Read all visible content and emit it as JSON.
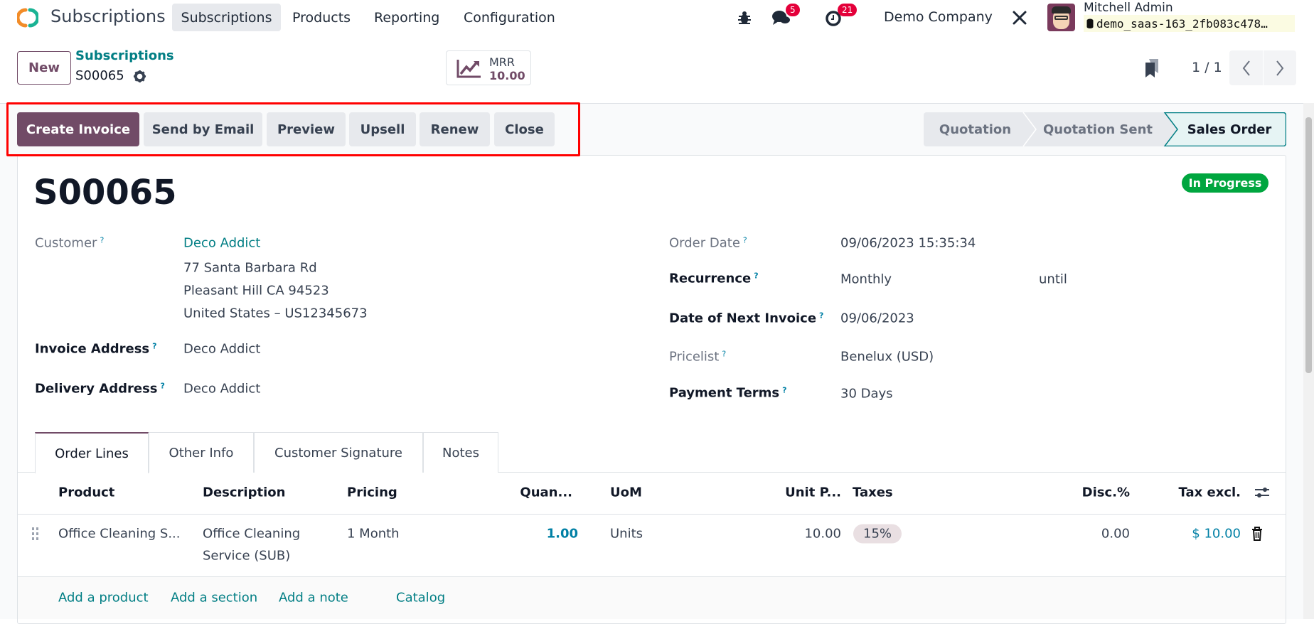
{
  "navbar": {
    "app_name": "Subscriptions",
    "menu": [
      "Subscriptions",
      "Products",
      "Reporting",
      "Configuration"
    ],
    "messages_count": "5",
    "activities_count": "21",
    "company": "Demo Company",
    "user_name": "Mitchell Admin",
    "database": "demo_saas-163_2fb083c478…"
  },
  "control_panel": {
    "new_label": "New",
    "breadcrumb_parent": "Subscriptions",
    "breadcrumb_current": "S00065",
    "mrr_label": "MRR",
    "mrr_value": "10.00",
    "pager": "1 / 1"
  },
  "actions": [
    "Create Invoice",
    "Send by Email",
    "Preview",
    "Upsell",
    "Renew",
    "Close"
  ],
  "statusbar": {
    "stages": [
      "Quotation",
      "Quotation Sent",
      "Sales Order"
    ],
    "current": "Sales Order"
  },
  "form": {
    "title": "S00065",
    "status_badge": "In Progress",
    "help_mark": "?",
    "customer_label": "Customer",
    "customer_name": "Deco Addict",
    "customer_address": [
      "77 Santa Barbara Rd",
      "Pleasant Hill CA 94523",
      "United States – US12345673"
    ],
    "invoice_address_label": "Invoice Address",
    "invoice_address": "Deco Addict",
    "delivery_address_label": "Delivery Address",
    "delivery_address": "Deco Addict",
    "order_date_label": "Order Date",
    "order_date": "09/06/2023 15:35:34",
    "recurrence_label": "Recurrence",
    "recurrence": "Monthly",
    "until_label": "until",
    "next_invoice_label": "Date of Next Invoice",
    "next_invoice": "09/06/2023",
    "pricelist_label": "Pricelist",
    "pricelist": "Benelux (USD)",
    "payment_terms_label": "Payment Terms",
    "payment_terms": "30 Days"
  },
  "tabs": [
    "Order Lines",
    "Other Info",
    "Customer Signature",
    "Notes"
  ],
  "order_lines": {
    "columns": [
      "Product",
      "Description",
      "Pricing",
      "Quan...",
      "UoM",
      "Unit P...",
      "Taxes",
      "Disc.%",
      "Tax excl."
    ],
    "rows": [
      {
        "product": "Office Cleaning S...",
        "description_1": "Office Cleaning",
        "description_2": "Service (SUB)",
        "pricing": "1 Month",
        "quantity": "1.00",
        "uom": "Units",
        "unit_price": "10.00",
        "taxes": "15%",
        "discount": "0.00",
        "subtotal": "$ 10.00"
      }
    ],
    "add_links": [
      "Add a product",
      "Add a section",
      "Add a note",
      "Catalog"
    ]
  },
  "colors": {
    "primary": "#714b67",
    "link": "#017e84",
    "badge": "#e4003a",
    "success": "#00a63f"
  }
}
